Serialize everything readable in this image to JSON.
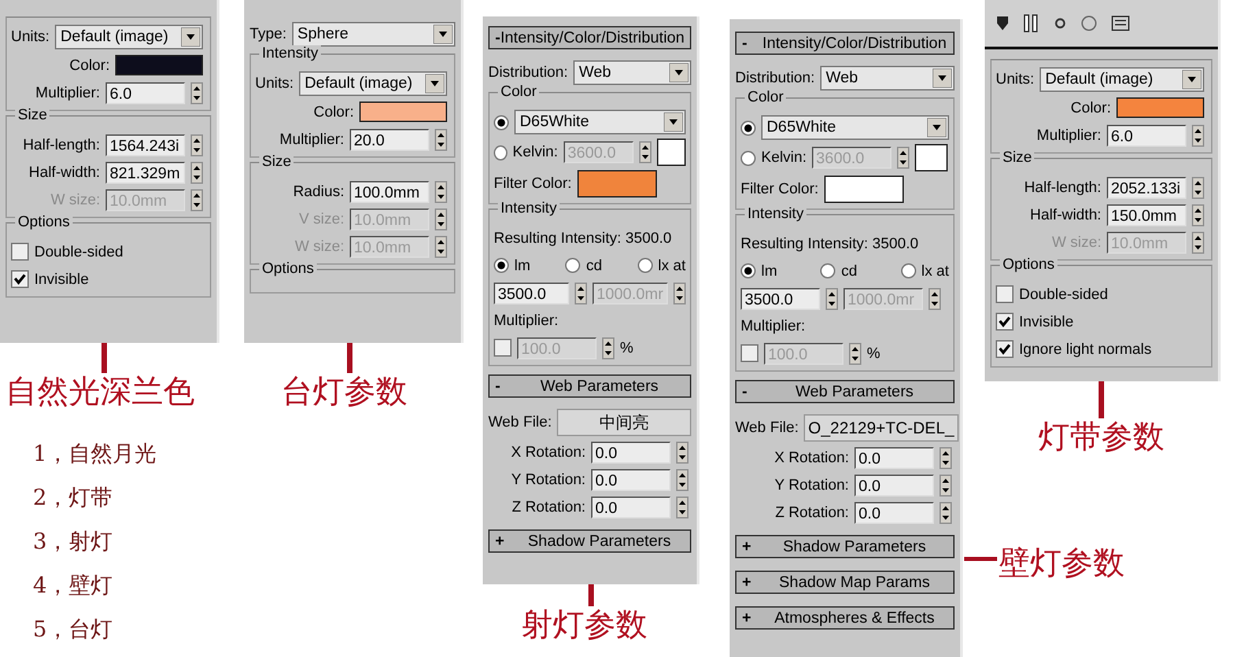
{
  "panels": [
    {
      "toolbar": false,
      "sections": [
        {
          "kind": "group",
          "rows": [
            {
              "kind": "field",
              "items": [
                {
                  "kind": "label",
                  "text": "Units:",
                  "disabled": false
                },
                {
                  "kind": "dropdown",
                  "value": "Default (image)"
                }
              ]
            },
            {
              "kind": "field",
              "items": [
                {
                  "kind": "label",
                  "text": "Color:",
                  "disabled": false
                },
                {
                  "kind": "swatch",
                  "color": "#0d0d1c"
                }
              ]
            },
            {
              "kind": "field",
              "items": [
                {
                  "kind": "label",
                  "text": "Multiplier:",
                  "disabled": false
                },
                {
                  "kind": "spinner",
                  "value": "6.0",
                  "disabled": false
                }
              ]
            }
          ]
        },
        {
          "kind": "group",
          "title": "Size",
          "rows": [
            {
              "kind": "field",
              "items": [
                {
                  "kind": "label",
                  "text": "Half-length:",
                  "disabled": false
                },
                {
                  "kind": "spinner",
                  "value": "1564.243i",
                  "disabled": false
                }
              ]
            },
            {
              "kind": "field",
              "items": [
                {
                  "kind": "label",
                  "text": "Half-width:",
                  "disabled": false
                },
                {
                  "kind": "spinner",
                  "value": "821.329m",
                  "disabled": false
                }
              ]
            },
            {
              "kind": "field",
              "items": [
                {
                  "kind": "label",
                  "text": "W size:",
                  "disabled": true
                },
                {
                  "kind": "spinner",
                  "value": "10.0mm",
                  "disabled": true
                }
              ]
            }
          ]
        },
        {
          "kind": "group",
          "title": "Options",
          "rows": [
            {
              "kind": "line",
              "items": [
                {
                  "kind": "checkbox",
                  "label": "Double-sided",
                  "checked": false
                }
              ]
            },
            {
              "kind": "line",
              "items": [
                {
                  "kind": "checkbox",
                  "label": "Invisible",
                  "checked": true
                }
              ]
            }
          ]
        }
      ]
    },
    {
      "toolbar": false,
      "sections": [
        {
          "kind": "rows",
          "rows": [
            {
              "kind": "line",
              "items": [
                {
                  "kind": "label",
                  "text": "Type:",
                  "disabled": false
                },
                {
                  "kind": "dropdown",
                  "value": "Sphere"
                }
              ]
            }
          ]
        },
        {
          "kind": "group",
          "title": "Intensity",
          "rows": [
            {
              "kind": "field",
              "items": [
                {
                  "kind": "label",
                  "text": "Units:",
                  "disabled": false
                },
                {
                  "kind": "dropdown",
                  "value": "Default (image)"
                }
              ]
            },
            {
              "kind": "field",
              "items": [
                {
                  "kind": "label",
                  "text": "Color:",
                  "disabled": false
                },
                {
                  "kind": "swatch",
                  "color": "#f8b08a"
                }
              ]
            },
            {
              "kind": "field",
              "items": [
                {
                  "kind": "label",
                  "text": "Multiplier:",
                  "disabled": false
                },
                {
                  "kind": "spinner",
                  "value": "20.0",
                  "disabled": false
                }
              ]
            }
          ]
        },
        {
          "kind": "group",
          "title": "Size",
          "rows": [
            {
              "kind": "field",
              "items": [
                {
                  "kind": "label",
                  "text": "Radius:",
                  "disabled": false
                },
                {
                  "kind": "spinner",
                  "value": "100.0mm",
                  "disabled": false
                }
              ]
            },
            {
              "kind": "field",
              "items": [
                {
                  "kind": "label",
                  "text": "V size:",
                  "disabled": true
                },
                {
                  "kind": "spinner",
                  "value": "10.0mm",
                  "disabled": true
                }
              ]
            },
            {
              "kind": "field",
              "items": [
                {
                  "kind": "label",
                  "text": "W size:",
                  "disabled": true
                },
                {
                  "kind": "spinner",
                  "value": "10.0mm",
                  "disabled": true
                }
              ]
            }
          ]
        },
        {
          "kind": "group",
          "title": "Options"
        }
      ]
    },
    {
      "toolbar": false,
      "sections": [
        {
          "kind": "rollout",
          "sign": "-",
          "title": "Intensity/Color/Distribution"
        },
        {
          "kind": "rows",
          "rows": [
            {
              "kind": "line",
              "items": [
                {
                  "kind": "label",
                  "text": "Distribution:",
                  "disabled": false
                },
                {
                  "kind": "dropdown",
                  "value": "Web"
                }
              ]
            }
          ]
        },
        {
          "kind": "group",
          "title": "Color",
          "rows": [
            {
              "kind": "line",
              "items": [
                {
                  "kind": "radio",
                  "selected": true
                },
                {
                  "kind": "dropdown",
                  "value": "D65White"
                }
              ]
            },
            {
              "kind": "line",
              "items": [
                {
                  "kind": "radio",
                  "label": "Kelvin:",
                  "selected": false
                },
                {
                  "kind": "spinner",
                  "value": "3600.0",
                  "disabled": true
                },
                {
                  "kind": "swatch",
                  "color": "#ffffff"
                }
              ]
            },
            {
              "kind": "line",
              "items": [
                {
                  "kind": "label",
                  "text": "Filter Color:",
                  "disabled": false
                },
                {
                  "kind": "swatch",
                  "color": "#f0843c"
                }
              ]
            }
          ]
        },
        {
          "kind": "group",
          "title": "Intensity",
          "rows": [
            {
              "kind": "line",
              "items": [
                {
                  "kind": "label",
                  "text": "Resulting Intensity:  3500.0",
                  "disabled": false
                }
              ]
            },
            {
              "kind": "line",
              "items": [
                {
                  "kind": "radio",
                  "label": "lm",
                  "selected": true
                },
                {
                  "kind": "radio",
                  "label": "cd",
                  "selected": false
                },
                {
                  "kind": "radio",
                  "label": "lx at",
                  "selected": false
                }
              ]
            },
            {
              "kind": "line",
              "items": [
                {
                  "kind": "spinner",
                  "value": "3500.0",
                  "disabled": false
                },
                {
                  "kind": "spinner",
                  "value": "1000.0mr",
                  "disabled": true
                }
              ]
            },
            {
              "kind": "line",
              "items": [
                {
                  "kind": "label",
                  "text": "Multiplier:",
                  "disabled": false
                }
              ]
            },
            {
              "kind": "line",
              "items": [
                {
                  "kind": "checkbox",
                  "checked": false
                },
                {
                  "kind": "spinner",
                  "value": "100.0",
                  "disabled": true
                },
                {
                  "kind": "label",
                  "text": "%",
                  "disabled": false
                }
              ]
            }
          ]
        },
        {
          "kind": "rollout",
          "sign": "-",
          "title": "Web Parameters"
        },
        {
          "kind": "rows",
          "rows": [
            {
              "kind": "line",
              "items": [
                {
                  "kind": "label",
                  "text": "Web File:",
                  "disabled": false
                },
                {
                  "kind": "button",
                  "label": "中间亮"
                }
              ]
            },
            {
              "kind": "field",
              "items": [
                {
                  "kind": "label",
                  "text": "X Rotation:",
                  "disabled": false
                },
                {
                  "kind": "spinner",
                  "value": "0.0",
                  "disabled": false
                }
              ]
            },
            {
              "kind": "field",
              "items": [
                {
                  "kind": "label",
                  "text": "Y Rotation:",
                  "disabled": false
                },
                {
                  "kind": "spinner",
                  "value": "0.0",
                  "disabled": false
                }
              ]
            },
            {
              "kind": "field",
              "items": [
                {
                  "kind": "label",
                  "text": "Z Rotation:",
                  "disabled": false
                },
                {
                  "kind": "spinner",
                  "value": "0.0",
                  "disabled": false
                }
              ]
            }
          ]
        },
        {
          "kind": "rollout",
          "sign": "+",
          "title": "Shadow Parameters"
        }
      ]
    },
    {
      "toolbar": false,
      "sections": [
        {
          "kind": "rollout",
          "sign": "-",
          "title": "Intensity/Color/Distribution"
        },
        {
          "kind": "rows",
          "rows": [
            {
              "kind": "line",
              "items": [
                {
                  "kind": "label",
                  "text": "Distribution:",
                  "disabled": false
                },
                {
                  "kind": "dropdown",
                  "value": "Web"
                }
              ]
            }
          ]
        },
        {
          "kind": "group",
          "title": "Color",
          "rows": [
            {
              "kind": "line",
              "items": [
                {
                  "kind": "radio",
                  "selected": true
                },
                {
                  "kind": "dropdown",
                  "value": "D65White"
                }
              ]
            },
            {
              "kind": "line",
              "items": [
                {
                  "kind": "radio",
                  "label": "Kelvin:",
                  "selected": false
                },
                {
                  "kind": "spinner",
                  "value": "3600.0",
                  "disabled": true
                },
                {
                  "kind": "swatch",
                  "color": "#ffffff"
                }
              ]
            },
            {
              "kind": "line",
              "items": [
                {
                  "kind": "label",
                  "text": "Filter Color:",
                  "disabled": false
                },
                {
                  "kind": "swatch",
                  "color": "#ffffff"
                }
              ]
            }
          ]
        },
        {
          "kind": "group",
          "title": "Intensity",
          "rows": [
            {
              "kind": "line",
              "items": [
                {
                  "kind": "label",
                  "text": "Resulting Intensity:  3500.0",
                  "disabled": false
                }
              ]
            },
            {
              "kind": "line",
              "items": [
                {
                  "kind": "radio",
                  "label": "lm",
                  "selected": true
                },
                {
                  "kind": "radio",
                  "label": "cd",
                  "selected": false
                },
                {
                  "kind": "radio",
                  "label": "lx at",
                  "selected": false
                }
              ]
            },
            {
              "kind": "line",
              "items": [
                {
                  "kind": "spinner",
                  "value": "3500.0",
                  "disabled": false
                },
                {
                  "kind": "spinner",
                  "value": "1000.0mr",
                  "disabled": true
                }
              ]
            },
            {
              "kind": "line",
              "items": [
                {
                  "kind": "label",
                  "text": "Multiplier:",
                  "disabled": false
                }
              ]
            },
            {
              "kind": "line",
              "items": [
                {
                  "kind": "checkbox",
                  "checked": false
                },
                {
                  "kind": "spinner",
                  "value": "100.0",
                  "disabled": true
                },
                {
                  "kind": "label",
                  "text": "%",
                  "disabled": false
                }
              ]
            }
          ]
        },
        {
          "kind": "rollout",
          "sign": "-",
          "title": "Web Parameters"
        },
        {
          "kind": "rows",
          "rows": [
            {
              "kind": "line",
              "items": [
                {
                  "kind": "label",
                  "text": "Web File:",
                  "disabled": false
                },
                {
                  "kind": "button",
                  "label": "O_22129+TC-DEL_"
                }
              ]
            },
            {
              "kind": "field",
              "items": [
                {
                  "kind": "label",
                  "text": "X Rotation:",
                  "disabled": false
                },
                {
                  "kind": "spinner",
                  "value": "0.0",
                  "disabled": false
                }
              ]
            },
            {
              "kind": "field",
              "items": [
                {
                  "kind": "label",
                  "text": "Y Rotation:",
                  "disabled": false
                },
                {
                  "kind": "spinner",
                  "value": "0.0",
                  "disabled": false
                }
              ]
            },
            {
              "kind": "field",
              "items": [
                {
                  "kind": "label",
                  "text": "Z Rotation:",
                  "disabled": false
                },
                {
                  "kind": "spinner",
                  "value": "0.0",
                  "disabled": false
                }
              ]
            }
          ]
        },
        {
          "kind": "rollout",
          "sign": "+",
          "title": "Shadow Parameters"
        },
        {
          "kind": "rollout",
          "sign": "+",
          "title": "Shadow Map Params"
        },
        {
          "kind": "rollout",
          "sign": "+",
          "title": "Atmospheres & Effects"
        }
      ]
    },
    {
      "toolbar": true,
      "sections": [
        {
          "kind": "group",
          "rows": [
            {
              "kind": "field",
              "items": [
                {
                  "kind": "label",
                  "text": "Units:",
                  "disabled": false
                },
                {
                  "kind": "dropdown",
                  "value": "Default (image)"
                }
              ]
            },
            {
              "kind": "field",
              "items": [
                {
                  "kind": "label",
                  "text": "Color:",
                  "disabled": false
                },
                {
                  "kind": "swatch",
                  "color": "#f4843e"
                }
              ]
            },
            {
              "kind": "field",
              "items": [
                {
                  "kind": "label",
                  "text": "Multiplier:",
                  "disabled": false
                },
                {
                  "kind": "spinner",
                  "value": "6.0",
                  "disabled": false
                }
              ]
            }
          ]
        },
        {
          "kind": "group",
          "title": "Size",
          "rows": [
            {
              "kind": "field",
              "items": [
                {
                  "kind": "label",
                  "text": "Half-length:",
                  "disabled": false
                },
                {
                  "kind": "spinner",
                  "value": "2052.133i",
                  "disabled": false
                }
              ]
            },
            {
              "kind": "field",
              "items": [
                {
                  "kind": "label",
                  "text": "Half-width:",
                  "disabled": false
                },
                {
                  "kind": "spinner",
                  "value": "150.0mm",
                  "disabled": false
                }
              ]
            },
            {
              "kind": "field",
              "items": [
                {
                  "kind": "label",
                  "text": "W size:",
                  "disabled": true
                },
                {
                  "kind": "spinner",
                  "value": "10.0mm",
                  "disabled": true
                }
              ]
            }
          ]
        },
        {
          "kind": "group",
          "title": "Options",
          "rows": [
            {
              "kind": "line",
              "items": [
                {
                  "kind": "checkbox",
                  "label": "Double-sided",
                  "checked": false
                }
              ]
            },
            {
              "kind": "line",
              "items": [
                {
                  "kind": "checkbox",
                  "label": "Invisible",
                  "checked": true
                }
              ]
            },
            {
              "kind": "line",
              "items": [
                {
                  "kind": "checkbox",
                  "label": "Ignore light normals",
                  "checked": true
                }
              ]
            }
          ]
        }
      ]
    }
  ],
  "callouts": [
    "自然光深兰色",
    "台灯参数",
    "射灯参数",
    "壁灯参数",
    "灯带参数"
  ],
  "notes": [
    "1，自然月光",
    "2，灯带",
    "3，射灯",
    "4，壁灯",
    "5，台灯"
  ]
}
